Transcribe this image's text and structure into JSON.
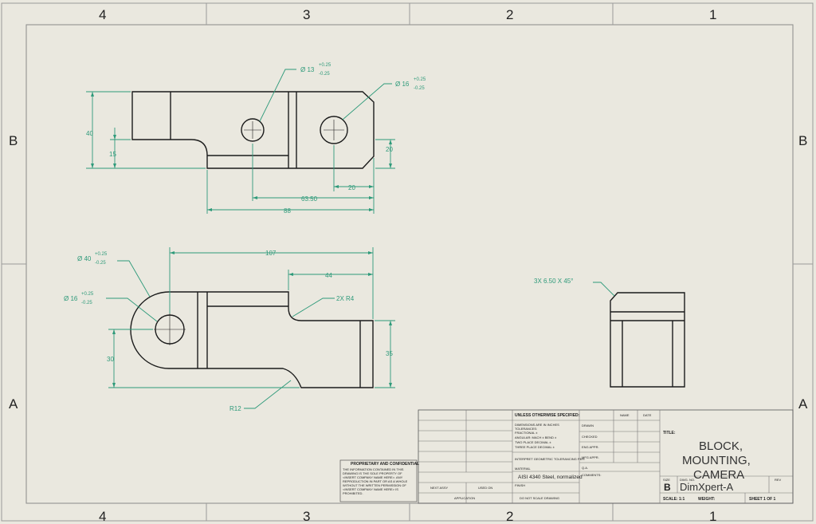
{
  "zones": {
    "columns": [
      "4",
      "3",
      "2",
      "1"
    ],
    "rows": [
      "B",
      "A"
    ]
  },
  "dimensions": {
    "top": {
      "hole_small": "Ø 13",
      "hole_small_tol_plus": "+0.25",
      "hole_small_tol_minus": "-0.25",
      "hole_large": "Ø 16",
      "hole_large_tol_plus": "+0.25",
      "hole_large_tol_minus": "-0.25",
      "height_overall": "40",
      "height_step": "15",
      "height_right": "20",
      "chamfer_offset": "20",
      "hole_spacing": "63.50",
      "length_overall": "88"
    },
    "front": {
      "boss_dia": "Ø 40",
      "boss_tol_plus": "+0.25",
      "boss_tol_minus": "-0.25",
      "bore_dia": "Ø 16",
      "bore_tol_plus": "+0.25",
      "bore_tol_minus": "-0.25",
      "length_overall": "107",
      "slot_length": "44",
      "fillet_radius": "2X R4",
      "height_left": "30",
      "height_right": "35",
      "bottom_radius": "R12"
    },
    "side": {
      "chamfer": "3X 6.50  X 45°"
    }
  },
  "title_block": {
    "tol_header": "UNLESS OTHERWISE SPECIFIED:",
    "tol_lines": [
      "DIMENSIONS ARE IN INCHES",
      "TOLERANCES:",
      "FRACTIONAL ±",
      "ANGULAR: MACH ±   BEND ±",
      "TWO PLACE DECIMAL   ±",
      "THREE PLACE DECIMAL   ±"
    ],
    "interpret": "INTERPRET GEOMETRIC TOLERANCING PER:",
    "material_label": "MATERIAL",
    "material": "AISI 4340 Steel, normalized",
    "finish_label": "FINISH",
    "next_assy": "NEXT ASSY",
    "used_on": "USED ON",
    "application": "APPLICATION",
    "do_not_scale": "DO NOT SCALE DRAWING",
    "name_col": "NAME",
    "date_col": "DATE",
    "rows": [
      "DRAWN",
      "CHECKED",
      "ENG APPR.",
      "MFG APPR.",
      "Q.A.",
      "COMMENTS:"
    ],
    "proprietary_title": "PROPRIETARY AND CONFIDENTIAL",
    "proprietary_lines": [
      "THE INFORMATION CONTAINED IN THIS",
      "DRAWING IS THE SOLE PROPERTY OF",
      "<INSERT COMPANY NAME HERE>. ANY",
      "REPRODUCTION IN PART OR AS A WHOLE",
      "WITHOUT THE WRITTEN PERMISSION OF",
      "<INSERT COMPANY NAME HERE> IS",
      "PROHIBITED."
    ],
    "title_label": "TITLE:",
    "title_lines": [
      "BLOCK,",
      "MOUNTING,",
      "CAMERA"
    ],
    "size_label": "SIZE",
    "size": "B",
    "dwg_no_label": "DWG. NO.",
    "dwg_no": "DimXpert-A",
    "rev_label": "REV",
    "scale": "SCALE: 1:1",
    "weight": "WEIGHT:",
    "sheet": "SHEET 1 OF 1"
  },
  "colors": {
    "paper": "#eae8df",
    "geometry": "#1b1b1b",
    "dimension": "#2e9a7a",
    "frame": "#8a8a8a"
  }
}
